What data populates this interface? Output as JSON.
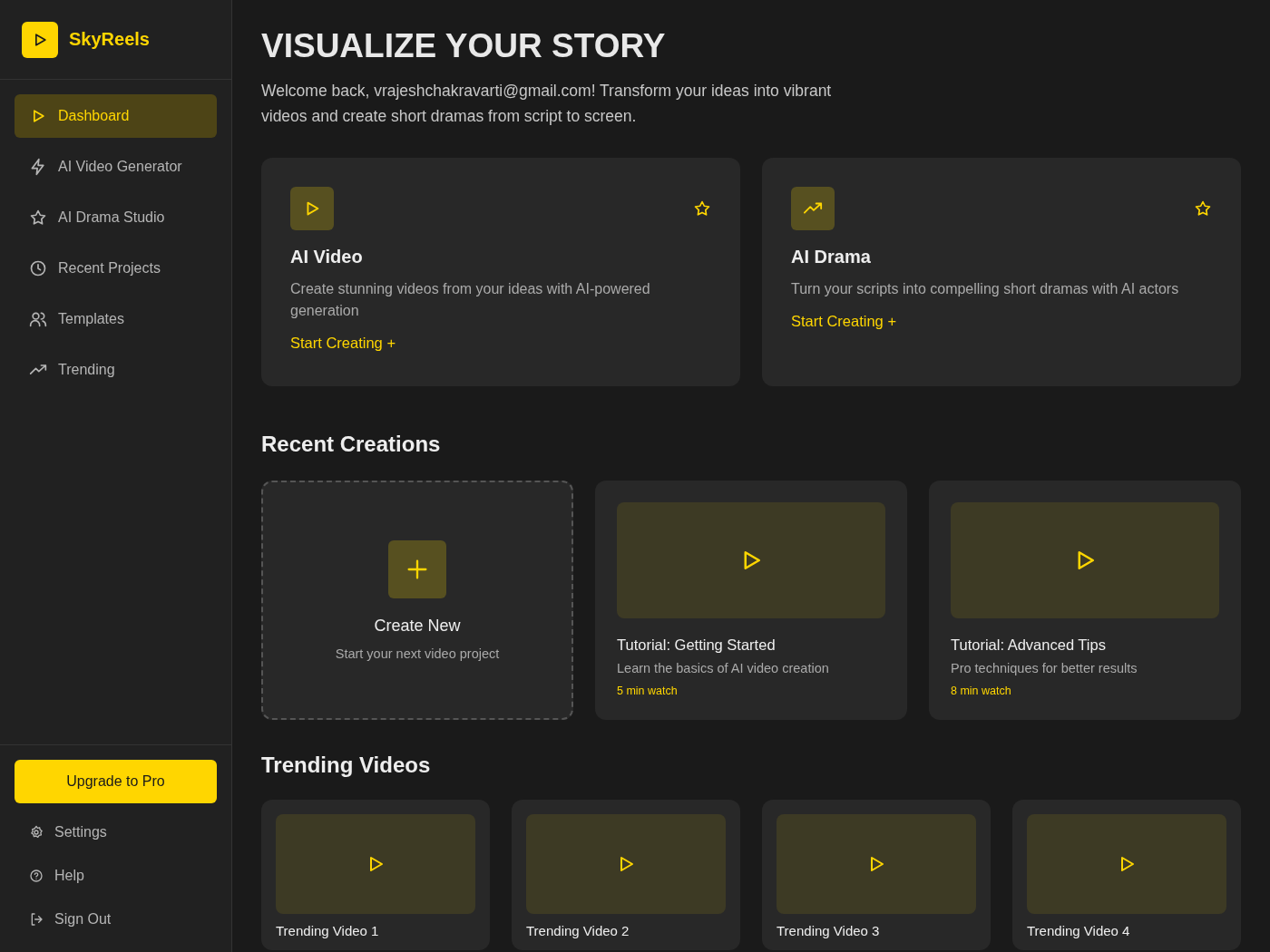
{
  "brand": {
    "name": "SkyReels"
  },
  "sidebar": {
    "items": [
      {
        "label": "Dashboard",
        "selected": true
      },
      {
        "label": "AI Video Generator",
        "selected": false
      },
      {
        "label": "AI Drama Studio",
        "selected": false
      },
      {
        "label": "Recent Projects",
        "selected": false
      },
      {
        "label": "Templates",
        "selected": false
      },
      {
        "label": "Trending",
        "selected": false
      }
    ],
    "upgrade_button": "Upgrade to Pro",
    "footer_items": [
      "Settings",
      "Help",
      "Sign Out"
    ]
  },
  "header": {
    "title": "VISUALIZE YOUR STORY",
    "subtitle": "Welcome back, vrajeshchakravarti@gmail.com! Transform your ideas into vibrant videos and create short dramas from script to screen."
  },
  "feature_cards": [
    {
      "title": "AI Video",
      "description": "Create stunning videos from your ideas with AI-powered generation",
      "action": "Start Creating",
      "action_icon": "+"
    },
    {
      "title": "AI Drama",
      "description": "Turn your scripts into compelling short dramas with AI actors",
      "action": "Start Creating",
      "action_icon": "+"
    }
  ],
  "recent_creations": {
    "title": "Recent Creations",
    "items": [
      {
        "kind": "create",
        "title": "Create New",
        "description": "Start your next video project"
      },
      {
        "kind": "tutorial",
        "title": "Tutorial: Getting Started",
        "description": "Learn the basics of AI video creation",
        "duration": "5 min watch"
      },
      {
        "kind": "tutorial",
        "title": "Tutorial: Advanced Tips",
        "description": "Pro techniques for better results",
        "duration": "8 min watch"
      }
    ]
  },
  "trending_videos": {
    "title": "Trending Videos",
    "items": [
      {
        "title": "Trending Video 1"
      },
      {
        "title": "Trending Video 2"
      },
      {
        "title": "Trending Video 3"
      },
      {
        "title": "Trending Video 4"
      }
    ]
  }
}
